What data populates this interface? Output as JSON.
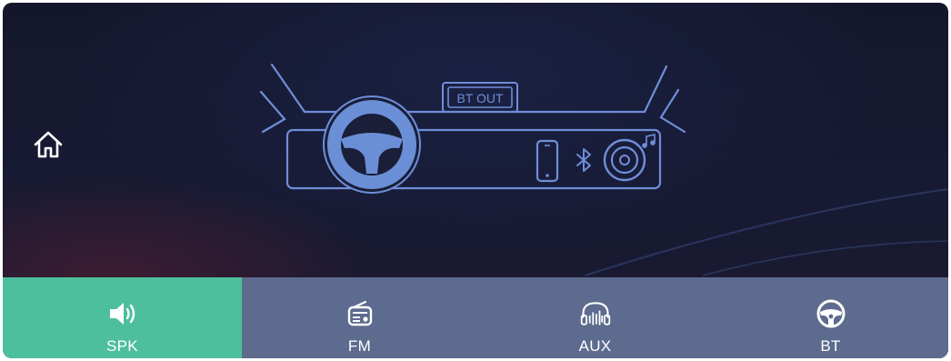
{
  "home": {
    "icon": "home-icon"
  },
  "scene": {
    "bt_out_label": "BT OUT",
    "icons": [
      "steering-wheel-icon",
      "phone-icon",
      "bluetooth-icon",
      "speaker-icon",
      "music-note-icon"
    ]
  },
  "tabs": [
    {
      "label": "SPK",
      "icon": "speaker-volume-icon",
      "active": true
    },
    {
      "label": "FM",
      "icon": "radio-icon",
      "active": false
    },
    {
      "label": "AUX",
      "icon": "headphones-icon",
      "active": false
    },
    {
      "label": "BT",
      "icon": "steering-wheel-icon",
      "active": false
    }
  ],
  "colors": {
    "active_tab": "#4dbf9c",
    "tab_bar": "#5d6b8e",
    "line_art": "#6f8ed8",
    "wheel_fill": "#6a8fd6"
  }
}
